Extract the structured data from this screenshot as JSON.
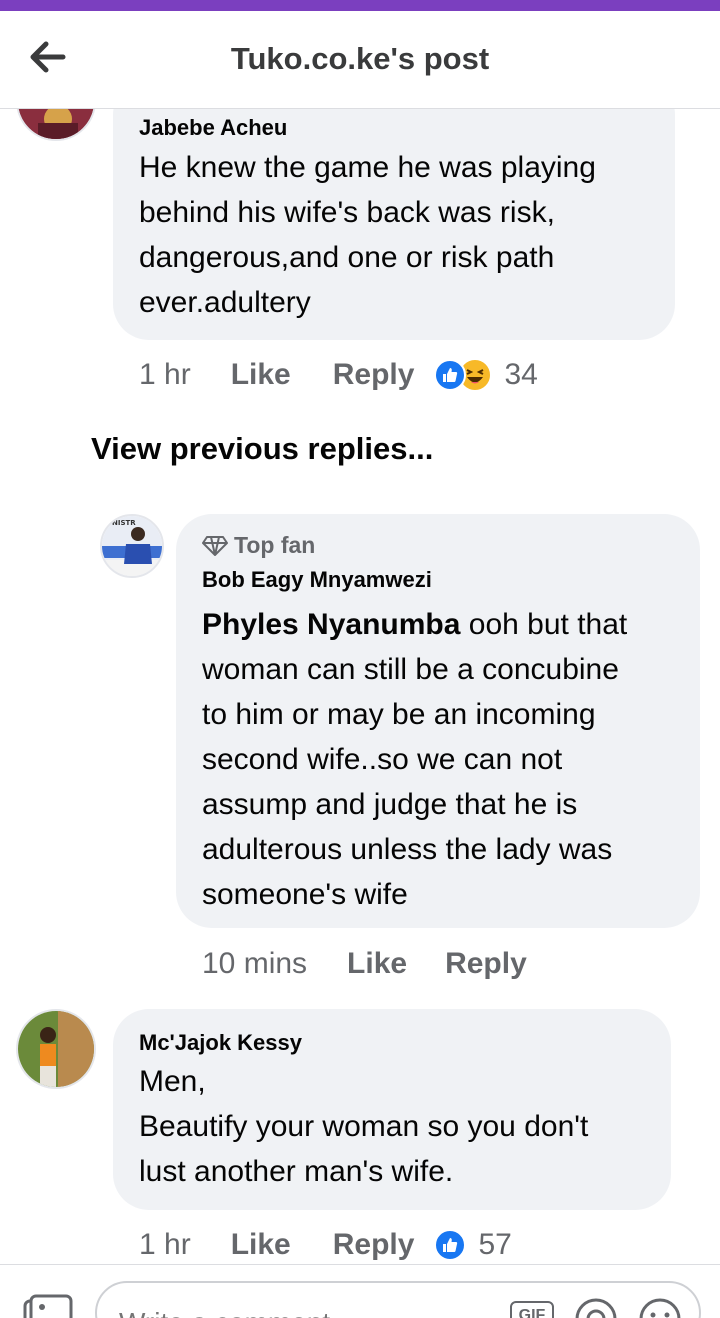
{
  "header": {
    "title": "Tuko.co.ke's post"
  },
  "comments": [
    {
      "author": "Jabebe Acheu",
      "lines": [
        "He knew the game he was playing",
        "behind his wife's back was risk,",
        "dangerous,and one or risk path",
        "ever.adultery"
      ],
      "time": "1 hr",
      "like_label": "Like",
      "reply_label": "Reply",
      "reaction_count": "34"
    },
    {
      "author": "Mc'Jajok Kessy",
      "lines": [
        "Men,",
        "Beautify your woman so you don't",
        "lust another man's wife."
      ],
      "time": "1 hr",
      "like_label": "Like",
      "reply_label": "Reply",
      "reaction_count": "57"
    }
  ],
  "view_previous": "View previous replies...",
  "reply": {
    "badge": "Top fan",
    "author": "Bob Eagy Mnyamwezi",
    "mention": "Phyles Nyanumba",
    "first_line_rest": " ooh but that",
    "lines": [
      "woman can still be a concubine",
      "to him or may be an incoming",
      "second wife..so we can not",
      "assump and judge that he is",
      "adulterous unless the lady was",
      "someone's wife"
    ],
    "time": "10 mins",
    "like_label": "Like",
    "reply_label": "Reply"
  },
  "composer": {
    "placeholder": "Write a comment...",
    "gif_label": "GIF"
  },
  "colors": {
    "accent": "#1877f2",
    "status": "#7b3fbf",
    "bubble": "#f0f2f5",
    "muted": "#65676b"
  },
  "icons": [
    "back-arrow-icon",
    "like-reaction-icon",
    "haha-reaction-icon",
    "diamond-icon",
    "photo-icon",
    "gif-icon",
    "sticker-icon",
    "emoji-icon"
  ]
}
